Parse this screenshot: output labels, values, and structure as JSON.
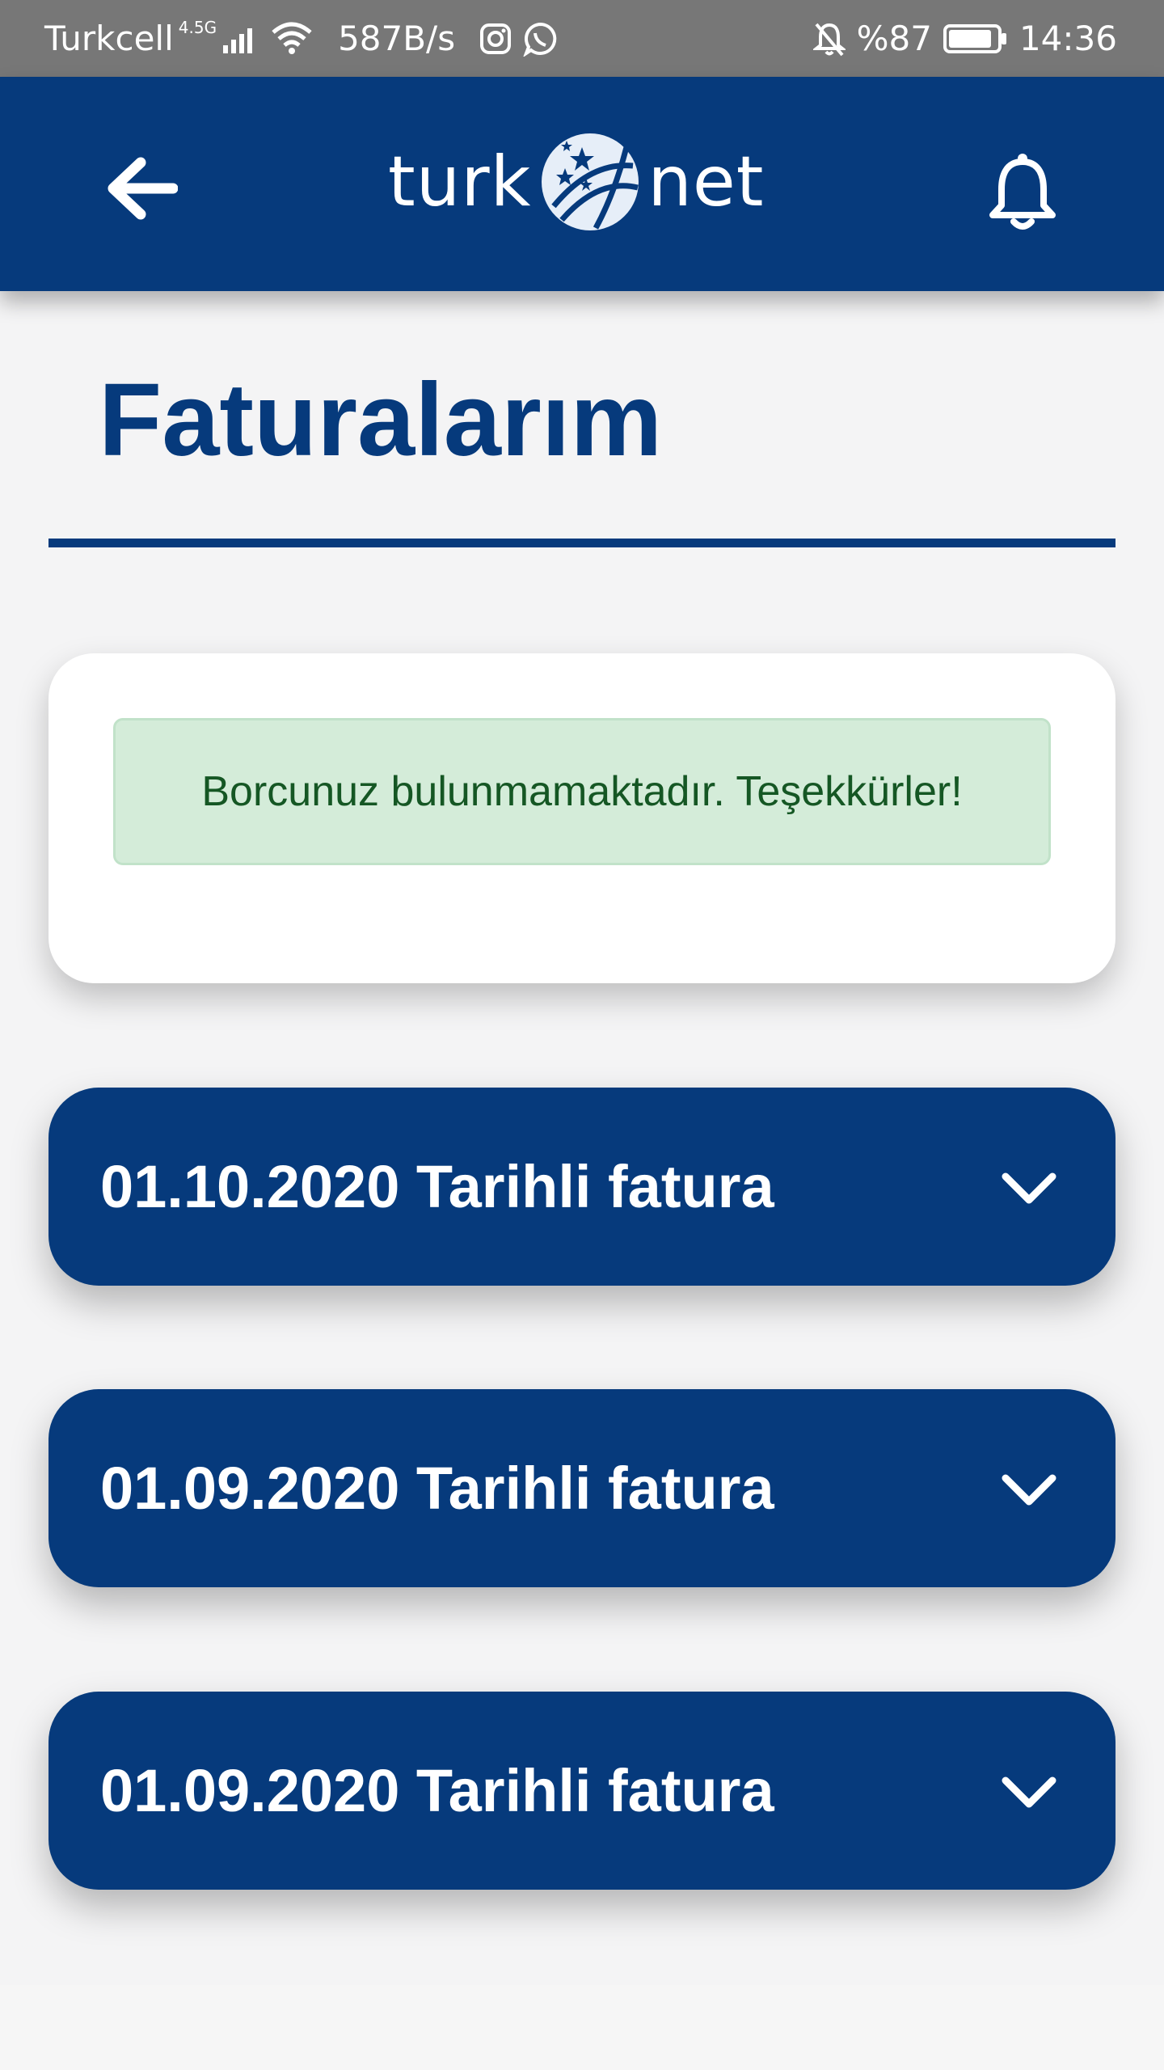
{
  "status_bar": {
    "carrier": "Turkcell",
    "network_type": "4.5G",
    "data_speed": "587B/s",
    "battery": "%87",
    "time": "14:36",
    "icons": [
      "signal-icon",
      "wifi-icon",
      "instagram-icon",
      "whatsapp-icon",
      "bell-off-icon",
      "battery-icon"
    ]
  },
  "app_bar": {
    "logo_left": "turk",
    "logo_right": "net",
    "back_icon": "arrow-left-icon",
    "notification_icon": "bell-icon"
  },
  "page": {
    "title": "Faturalarım"
  },
  "alert": {
    "message": "Borcunuz bulunmamaktadır. Teşekkürler!"
  },
  "invoices": [
    {
      "label": "01.10.2020 Tarihli fatura"
    },
    {
      "label": "01.09.2020 Tarihli fatura"
    },
    {
      "label": "01.09.2020 Tarihli fatura"
    }
  ],
  "colors": {
    "brand_blue": "#063a7c",
    "status_bar": "#777777",
    "page_bg": "#f4f4f5",
    "alert_bg": "#d4ecd9",
    "alert_text": "#155724"
  }
}
